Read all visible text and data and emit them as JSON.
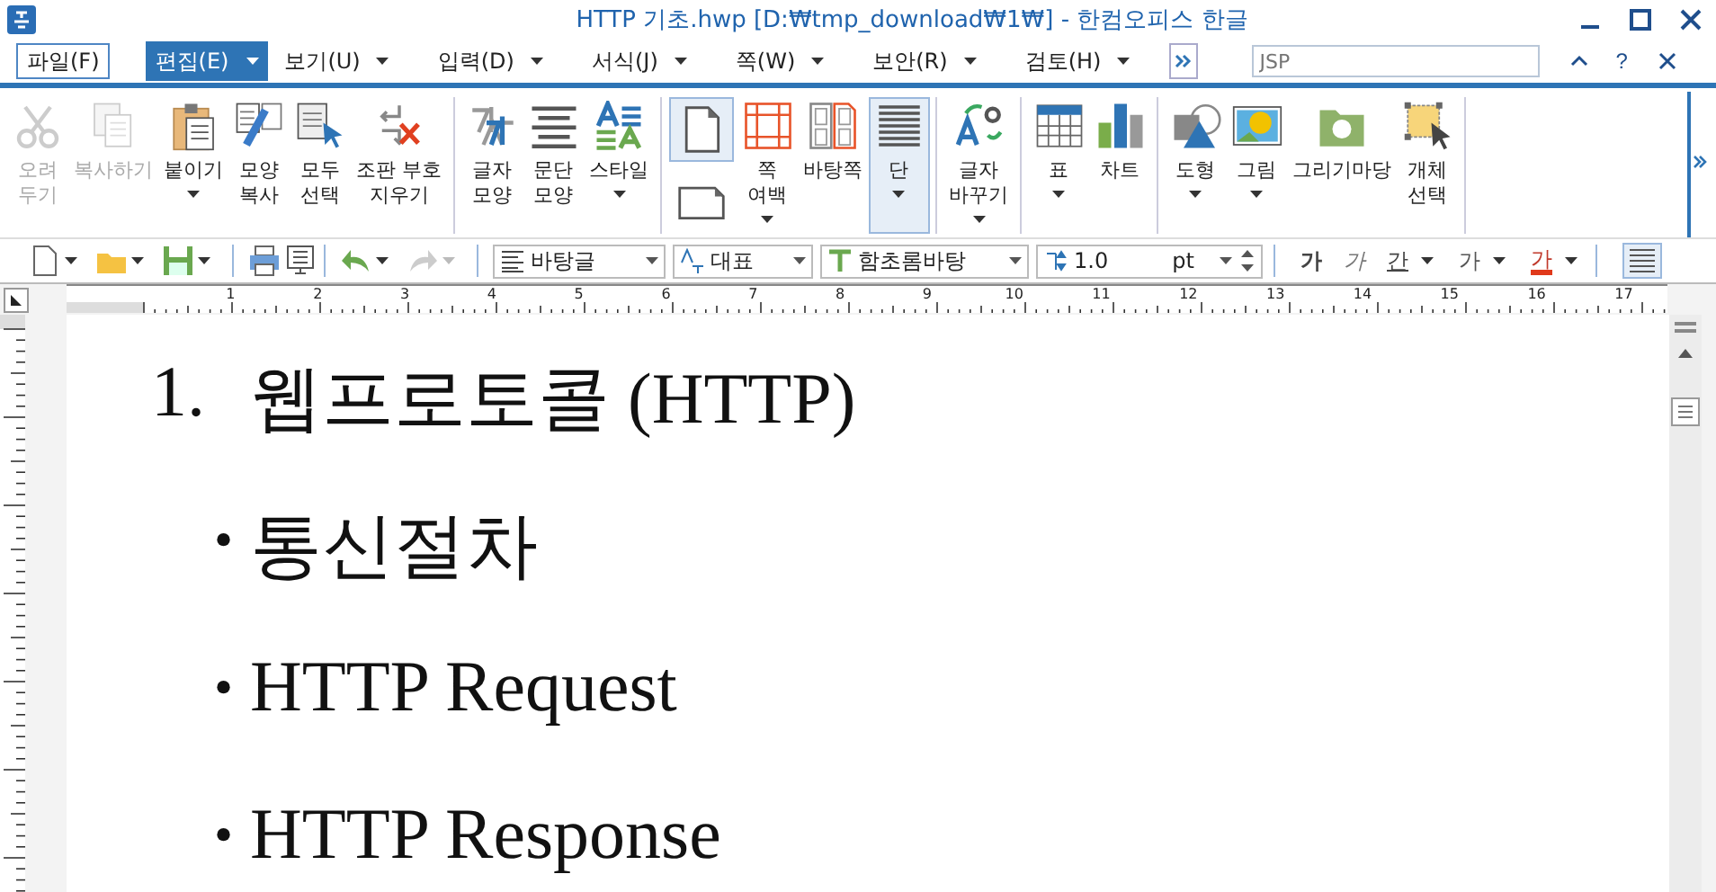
{
  "window": {
    "title": "HTTP 기초.hwp [D:₩tmp_download₩1₩] - 한컴오피스 한글",
    "help": "?"
  },
  "menu": [
    {
      "label": "파일(F)",
      "kind": "file",
      "selected": false,
      "dropdown": false
    },
    {
      "label": "편집(E)",
      "kind": "menu",
      "selected": true,
      "dropdown": true
    },
    {
      "label": "보기(U)",
      "kind": "menu",
      "selected": false,
      "dropdown": true
    },
    {
      "label": "입력(D)",
      "kind": "menu",
      "selected": false,
      "dropdown": true
    },
    {
      "label": "서식(J)",
      "kind": "menu",
      "selected": false,
      "dropdown": true
    },
    {
      "label": "쪽(W)",
      "kind": "menu",
      "selected": false,
      "dropdown": true
    },
    {
      "label": "보안(R)",
      "kind": "menu",
      "selected": false,
      "dropdown": true
    },
    {
      "label": "검토(H)",
      "kind": "menu",
      "selected": false,
      "dropdown": true
    }
  ],
  "search": {
    "placeholder": "JSP"
  },
  "ribbon": [
    [
      {
        "kind": "scissors",
        "lines": [
          "오려",
          "두기"
        ],
        "disabled": true,
        "selected": false,
        "dropdown": false
      },
      {
        "kind": "copy",
        "lines": [
          "복사하기"
        ],
        "disabled": true,
        "selected": false,
        "dropdown": false
      },
      {
        "kind": "paste",
        "lines": [
          "붙이기"
        ],
        "disabled": false,
        "selected": false,
        "dropdown": true
      },
      {
        "kind": "brush",
        "lines": [
          "모양",
          "복사"
        ],
        "disabled": false,
        "selected": false,
        "dropdown": false
      },
      {
        "kind": "selectall",
        "lines": [
          "모두",
          "선택"
        ],
        "disabled": false,
        "selected": false,
        "dropdown": false
      },
      {
        "kind": "clearmarks",
        "lines": [
          "조판 부호",
          "지우기"
        ],
        "disabled": false,
        "selected": false,
        "dropdown": false
      }
    ],
    [
      {
        "kind": "charshape",
        "lines": [
          "글자",
          "모양"
        ],
        "disabled": false,
        "selected": false,
        "dropdown": false
      },
      {
        "kind": "parashape",
        "lines": [
          "문단",
          "모양"
        ],
        "disabled": false,
        "selected": false,
        "dropdown": false
      },
      {
        "kind": "style",
        "lines": [
          "스타일"
        ],
        "disabled": false,
        "selected": false,
        "dropdown": true
      }
    ],
    [
      {
        "kind": "pages",
        "selected": true
      },
      {
        "kind": "margins",
        "lines": [
          "쪽",
          "여백"
        ],
        "disabled": false,
        "selected": false,
        "dropdown": true
      },
      {
        "kind": "master",
        "lines": [
          "바탕쪽"
        ],
        "disabled": false,
        "selected": false,
        "dropdown": false
      },
      {
        "kind": "columns",
        "lines": [
          "단"
        ],
        "disabled": false,
        "selected": true,
        "dropdown": true
      }
    ],
    [
      {
        "kind": "replace",
        "lines": [
          "글자",
          "바꾸기"
        ],
        "disabled": false,
        "selected": false,
        "dropdown": true
      }
    ],
    [
      {
        "kind": "table",
        "lines": [
          "표"
        ],
        "disabled": false,
        "selected": false,
        "dropdown": true
      },
      {
        "kind": "chart",
        "lines": [
          "차트"
        ],
        "disabled": false,
        "selected": false,
        "dropdown": false
      }
    ],
    [
      {
        "kind": "shapes",
        "lines": [
          "도형"
        ],
        "disabled": false,
        "selected": false,
        "dropdown": true
      },
      {
        "kind": "picture",
        "lines": [
          "그림"
        ],
        "disabled": false,
        "selected": false,
        "dropdown": true
      },
      {
        "kind": "clipart",
        "lines": [
          "그리기마당"
        ],
        "disabled": false,
        "selected": false,
        "dropdown": false
      },
      {
        "kind": "objselect",
        "lines": [
          "개체",
          "선택"
        ],
        "disabled": false,
        "selected": false,
        "dropdown": false
      }
    ]
  ],
  "toolbar": {
    "style": "바탕글",
    "language": "대표",
    "font": "함초롬바탕",
    "size": "1.0",
    "unit": "pt",
    "format": [
      {
        "kind": "bold",
        "glyph": "가",
        "dropdown": false
      },
      {
        "kind": "italic",
        "glyph": "가",
        "dropdown": false
      },
      {
        "kind": "underline",
        "glyph": "간",
        "dropdown": true
      },
      {
        "kind": "outline",
        "glyph": "가",
        "dropdown": true
      },
      {
        "kind": "color",
        "glyph": "가",
        "dropdown": true
      }
    ]
  },
  "ruler": [
    "1",
    "2",
    "3",
    "4",
    "5",
    "6",
    "7",
    "8",
    "9",
    "10",
    "11",
    "12",
    "13",
    "14",
    "15",
    "16",
    "17"
  ],
  "document": [
    {
      "kind": "numbered",
      "marker": "1.",
      "text": "웹프로토콜 (HTTP)"
    },
    {
      "kind": "bullet",
      "marker": "•",
      "text": "통신절차"
    },
    {
      "kind": "bullet",
      "marker": "•",
      "text": "HTTP Request"
    },
    {
      "kind": "bullet",
      "marker": "•",
      "text": "HTTP Response"
    }
  ]
}
